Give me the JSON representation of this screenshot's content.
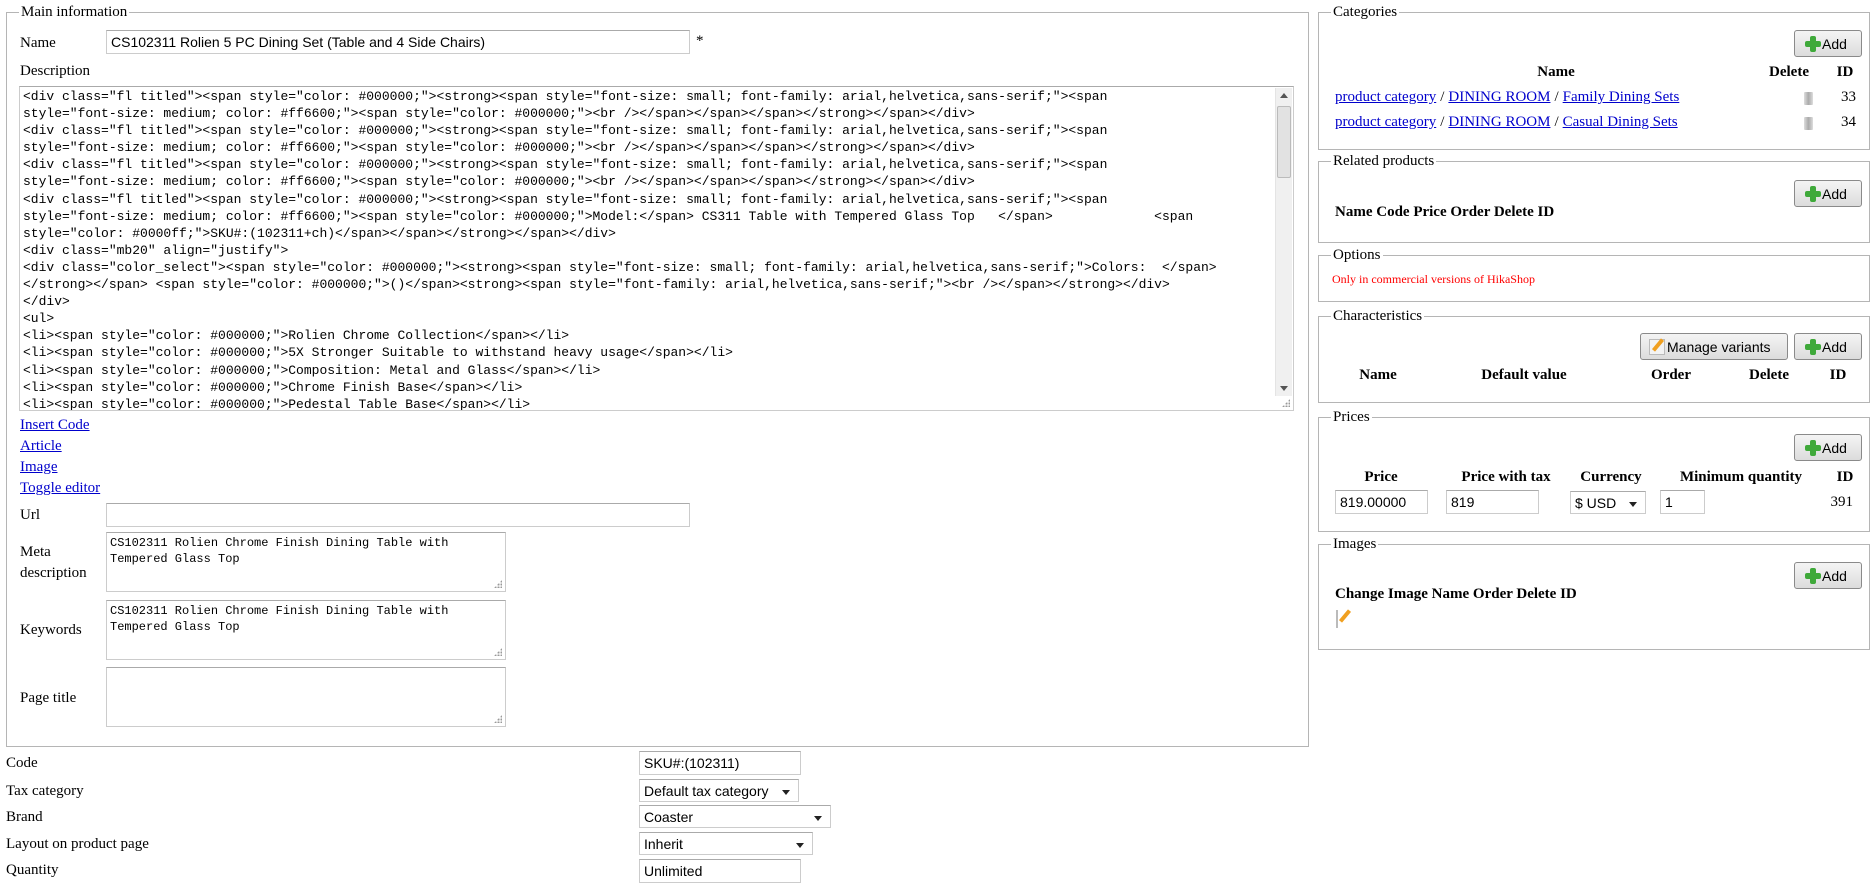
{
  "main": {
    "legend": "Main information",
    "name_label": "Name",
    "name_value": "CS102311 Rolien 5 PC Dining Set (Table and 4 Side Chairs)",
    "required_mark": "*",
    "description_label": "Description",
    "description_lines": [
      "<div class=\"fl titled\"><span style=\"color: #000000;\"><strong><span style=\"font-size: small; font-family: arial,helvetica,sans-serif;\"><span",
      "style=\"font-size: medium; color: #ff6600;\"><span style=\"color: #000000;\"><br /></span></span></span></strong></span></div>",
      "<div class=\"fl titled\"><span style=\"color: #000000;\"><strong><span style=\"font-size: small; font-family: arial,helvetica,sans-serif;\"><span",
      "style=\"font-size: medium; color: #ff6600;\"><span style=\"color: #000000;\"><br /></span></span></span></strong></span></div>",
      "<div class=\"fl titled\"><span style=\"color: #000000;\"><strong><span style=\"font-size: small; font-family: arial,helvetica,sans-serif;\"><span",
      "style=\"font-size: medium; color: #ff6600;\"><span style=\"color: #000000;\"><br /></span></span></span></strong></span></div>",
      "<div class=\"fl titled\"><span style=\"color: #000000;\"><strong><span style=\"font-size: small; font-family: arial,helvetica,sans-serif;\"><span",
      "style=\"font-size: medium; color: #ff6600;\"><span style=\"color: #000000;\">Model:</span> CS311 Table with Tempered Glass Top   </span>             <span",
      "style=\"color: #0000ff;\">SKU#:(102311+ch)</span></span></strong></span></div>",
      "<div class=\"mb20\" align=\"justify\">",
      "<div class=\"color_select\"><span style=\"color: #000000;\"><strong><span style=\"font-size: small; font-family: arial,helvetica,sans-serif;\">Colors:  </span>",
      "</strong></span> <span style=\"color: #000000;\">()</span><strong><span style=\"font-family: arial,helvetica,sans-serif;\"><br /></span></strong></div>",
      "</div>",
      "<ul>",
      "<li><span style=\"color: #000000;\">Rolien Chrome Collection</span></li>",
      "<li><span style=\"color: #000000;\">5X Stronger Suitable to withstand heavy usage</span></li>",
      "<li><span style=\"color: #000000;\">Composition: Metal and Glass</span></li>",
      "<li><span style=\"color: #000000;\">Chrome Finish Base</span></li>",
      "<li><span style=\"color: #000000;\">Pedestal Table Base</span></li>"
    ],
    "editor_links": [
      "Insert Code",
      "Article",
      "Image",
      "Toggle editor"
    ],
    "url_label": "Url",
    "url_value": "",
    "meta_label_1": "Meta",
    "meta_label_2": "description",
    "meta_value": "CS102311 Rolien Chrome Finish Dining Table with Tempered Glass Top",
    "keywords_label": "Keywords",
    "keywords_value": "CS102311 Rolien Chrome Finish Dining Table with Tempered Glass Top",
    "page_title_label": "Page title",
    "page_title_value": ""
  },
  "details": {
    "code_label": "Code",
    "code_value": "SKU#:(102311)",
    "tax_label": "Tax category",
    "tax_value": "Default tax category",
    "brand_label": "Brand",
    "brand_value": "Coaster",
    "layout_label": "Layout on product page",
    "layout_value": "Inherit",
    "quantity_label": "Quantity",
    "quantity_value": "Unlimited"
  },
  "categories": {
    "legend": "Categories",
    "add_label": "Add",
    "headers": {
      "name": "Name",
      "delete": "Delete",
      "id": "ID"
    },
    "rows": [
      {
        "path": [
          "product category",
          "DINING ROOM",
          "Family Dining Sets"
        ],
        "id": "33"
      },
      {
        "path": [
          "product category",
          "DINING ROOM",
          "Casual Dining Sets"
        ],
        "id": "34"
      }
    ],
    "separator": "/"
  },
  "related": {
    "legend": "Related products",
    "add_label": "Add",
    "headers": "Name Code Price Order Delete ID"
  },
  "options": {
    "legend": "Options",
    "notice": "Only in commercial versions of HikaShop",
    "notice_color": "#ff0000"
  },
  "characteristics": {
    "legend": "Characteristics",
    "manage_label": "Manage variants",
    "add_label": "Add",
    "headers": {
      "name": "Name",
      "default": "Default value",
      "order": "Order",
      "delete": "Delete",
      "id": "ID"
    }
  },
  "prices": {
    "legend": "Prices",
    "add_label": "Add",
    "headers": {
      "price": "Price",
      "price_tax": "Price with tax",
      "currency": "Currency",
      "min_qty": "Minimum quantity",
      "id": "ID"
    },
    "row": {
      "price": "819.00000",
      "price_tax": "819",
      "currency": "$ USD",
      "min_qty": "1",
      "id": "391"
    }
  },
  "images": {
    "legend": "Images",
    "add_label": "Add",
    "headers": "Change Image Name Order Delete ID"
  }
}
